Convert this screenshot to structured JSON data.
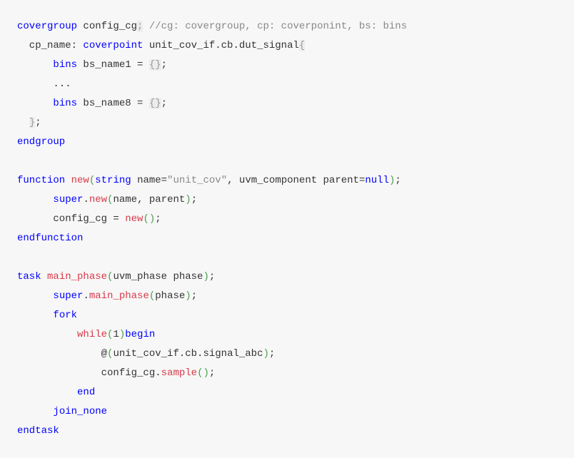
{
  "lines": [
    {
      "segments": [
        {
          "cls": "kw-blue",
          "text": "covergroup"
        },
        {
          "cls": "txt",
          "text": " config_cg"
        },
        {
          "cls": "brace",
          "text": ";"
        },
        {
          "cls": "txt",
          "text": " "
        },
        {
          "cls": "comment",
          "text": "//cg: covergroup, cp: coverponint, bs: bins"
        }
      ]
    },
    {
      "segments": [
        {
          "cls": "txt",
          "text": "  cp_name: "
        },
        {
          "cls": "kw-blue",
          "text": "coverpoint"
        },
        {
          "cls": "txt",
          "text": " unit_cov_if.cb.dut_signal"
        },
        {
          "cls": "brace",
          "text": "{"
        }
      ]
    },
    {
      "segments": [
        {
          "cls": "txt",
          "text": "      "
        },
        {
          "cls": "kw-blue",
          "text": "bins"
        },
        {
          "cls": "txt",
          "text": " bs_name1 = "
        },
        {
          "cls": "brace",
          "text": "{}"
        },
        {
          "cls": "txt",
          "text": ";"
        }
      ]
    },
    {
      "segments": [
        {
          "cls": "txt",
          "text": "      ..."
        }
      ]
    },
    {
      "segments": [
        {
          "cls": "txt",
          "text": "      "
        },
        {
          "cls": "kw-blue",
          "text": "bins"
        },
        {
          "cls": "txt",
          "text": " bs_name8 = "
        },
        {
          "cls": "brace",
          "text": "{}"
        },
        {
          "cls": "txt",
          "text": ";"
        }
      ]
    },
    {
      "segments": [
        {
          "cls": "txt",
          "text": "  "
        },
        {
          "cls": "brace",
          "text": "}"
        },
        {
          "cls": "txt",
          "text": ";"
        }
      ]
    },
    {
      "segments": [
        {
          "cls": "kw-blue",
          "text": "endgroup"
        }
      ]
    },
    {
      "segments": [
        {
          "cls": "txt",
          "text": ""
        }
      ]
    },
    {
      "segments": [
        {
          "cls": "kw-blue",
          "text": "function"
        },
        {
          "cls": "txt",
          "text": " "
        },
        {
          "cls": "kw-red",
          "text": "new"
        },
        {
          "cls": "paren",
          "text": "("
        },
        {
          "cls": "kw-blue",
          "text": "string"
        },
        {
          "cls": "txt",
          "text": " name="
        },
        {
          "cls": "str",
          "text": "\"unit_cov\""
        },
        {
          "cls": "txt",
          "text": ", uvm_component parent="
        },
        {
          "cls": "kw-blue",
          "text": "null"
        },
        {
          "cls": "paren",
          "text": ")"
        },
        {
          "cls": "txt",
          "text": ";"
        }
      ]
    },
    {
      "segments": [
        {
          "cls": "txt",
          "text": "      "
        },
        {
          "cls": "kw-blue",
          "text": "super"
        },
        {
          "cls": "txt",
          "text": "."
        },
        {
          "cls": "kw-red",
          "text": "new"
        },
        {
          "cls": "paren",
          "text": "("
        },
        {
          "cls": "txt",
          "text": "name, parent"
        },
        {
          "cls": "paren",
          "text": ")"
        },
        {
          "cls": "txt",
          "text": ";"
        }
      ]
    },
    {
      "segments": [
        {
          "cls": "txt",
          "text": "      config_cg = "
        },
        {
          "cls": "kw-red",
          "text": "new"
        },
        {
          "cls": "paren",
          "text": "()"
        },
        {
          "cls": "txt",
          "text": ";"
        }
      ]
    },
    {
      "segments": [
        {
          "cls": "kw-blue",
          "text": "endfunction"
        }
      ]
    },
    {
      "segments": [
        {
          "cls": "txt",
          "text": ""
        }
      ]
    },
    {
      "segments": [
        {
          "cls": "kw-blue",
          "text": "task"
        },
        {
          "cls": "txt",
          "text": " "
        },
        {
          "cls": "kw-red",
          "text": "main_phase"
        },
        {
          "cls": "paren",
          "text": "("
        },
        {
          "cls": "txt",
          "text": "uvm_phase phase"
        },
        {
          "cls": "paren",
          "text": ")"
        },
        {
          "cls": "txt",
          "text": ";"
        }
      ]
    },
    {
      "segments": [
        {
          "cls": "txt",
          "text": "      "
        },
        {
          "cls": "kw-blue",
          "text": "super"
        },
        {
          "cls": "txt",
          "text": "."
        },
        {
          "cls": "kw-red",
          "text": "main_phase"
        },
        {
          "cls": "paren",
          "text": "("
        },
        {
          "cls": "txt",
          "text": "phase"
        },
        {
          "cls": "paren",
          "text": ")"
        },
        {
          "cls": "txt",
          "text": ";"
        }
      ]
    },
    {
      "segments": [
        {
          "cls": "txt",
          "text": "      "
        },
        {
          "cls": "kw-blue",
          "text": "fork"
        }
      ]
    },
    {
      "segments": [
        {
          "cls": "txt",
          "text": "          "
        },
        {
          "cls": "kw-red",
          "text": "while"
        },
        {
          "cls": "paren",
          "text": "("
        },
        {
          "cls": "txt",
          "text": "1"
        },
        {
          "cls": "paren",
          "text": ")"
        },
        {
          "cls": "kw-blue",
          "text": "begin"
        }
      ]
    },
    {
      "segments": [
        {
          "cls": "txt",
          "text": "              @"
        },
        {
          "cls": "paren",
          "text": "("
        },
        {
          "cls": "txt",
          "text": "unit_cov_if.cb.signal_abc"
        },
        {
          "cls": "paren",
          "text": ")"
        },
        {
          "cls": "txt",
          "text": ";"
        }
      ]
    },
    {
      "segments": [
        {
          "cls": "txt",
          "text": "              config_cg."
        },
        {
          "cls": "kw-red",
          "text": "sample"
        },
        {
          "cls": "paren",
          "text": "()"
        },
        {
          "cls": "txt",
          "text": ";"
        }
      ]
    },
    {
      "segments": [
        {
          "cls": "txt",
          "text": "          "
        },
        {
          "cls": "kw-blue",
          "text": "end"
        }
      ]
    },
    {
      "segments": [
        {
          "cls": "txt",
          "text": "      "
        },
        {
          "cls": "kw-blue",
          "text": "join_none"
        }
      ]
    },
    {
      "segments": [
        {
          "cls": "kw-blue",
          "text": "endtask"
        }
      ]
    }
  ]
}
